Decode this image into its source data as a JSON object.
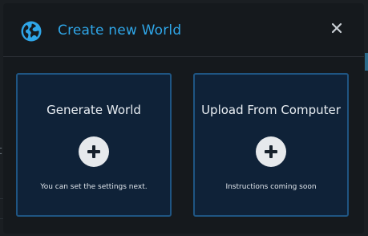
{
  "modal": {
    "title": "Create new World",
    "icons": {
      "title": "globe-icon",
      "close": "close-icon",
      "card_action": "plus-icon"
    },
    "options": [
      {
        "title": "Generate World",
        "subtitle": "You can set the settings next."
      },
      {
        "title": "Upload From Computer",
        "subtitle": "Instructions coming soon"
      }
    ]
  },
  "background": {
    "partial_glyph": "t"
  },
  "colors": {
    "accent": "#2fa6e8",
    "modal_bg": "#15191d",
    "card_bg": "#0f2238",
    "card_border": "#1f5582",
    "text": "#e9eef3"
  }
}
